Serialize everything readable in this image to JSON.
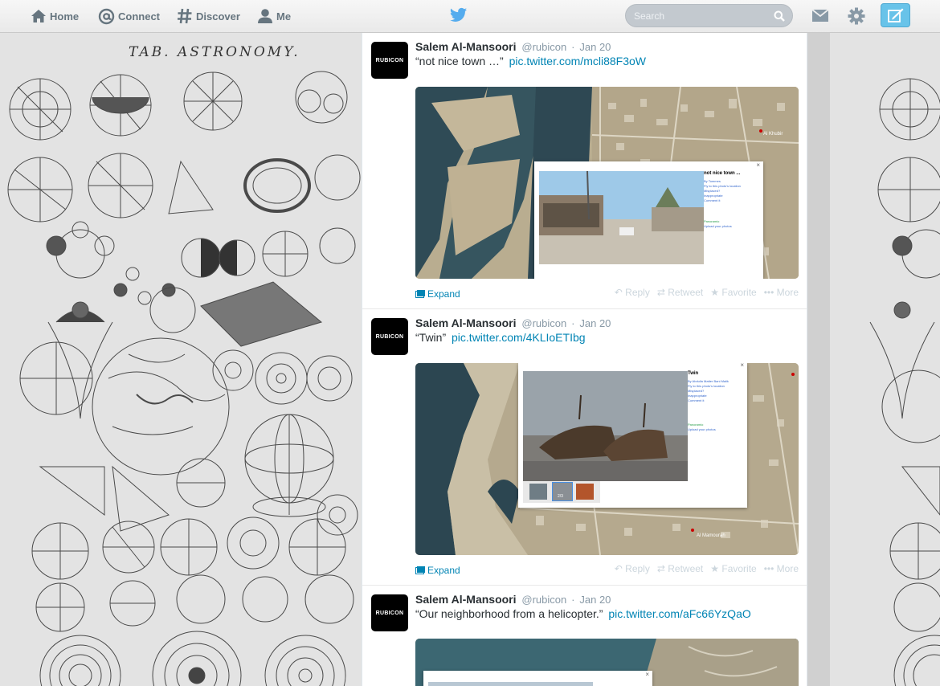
{
  "nav": {
    "home": "Home",
    "connect": "Connect",
    "discover": "Discover",
    "me": "Me"
  },
  "search": {
    "placeholder": "Search"
  },
  "background": {
    "plate_title": "TAB. ASTRONOMY."
  },
  "tweets": [
    {
      "avatar_text": "RUBICON",
      "fullname": "Salem Al-Mansoori",
      "screenname": "@rubicon",
      "time": "Jan 20",
      "text": "“not nice town …”",
      "link": "pic.twitter.com/mcli88F3oW",
      "popup_title": "not nice town ...",
      "popup_links": [
        "By Tommes",
        "Fly to this photo's location",
        "Misplaced?",
        "Inappropriate",
        "Comment it",
        "Panoramio",
        "Upload your photos"
      ],
      "map_label": "Al Khubir",
      "expand": "Expand",
      "actions": {
        "reply": "Reply",
        "retweet": "Retweet",
        "favorite": "Favorite",
        "more": "More"
      }
    },
    {
      "avatar_text": "RUBICON",
      "fullname": "Salem Al-Mansoori",
      "screenname": "@rubicon",
      "time": "Jan 20",
      "text": "“Twin”",
      "link": "pic.twitter.com/4KLIoETIbg",
      "popup_title": "Twin",
      "popup_links": [
        "By Abdulla Matter Bani Malik",
        "Fly to this photo's location",
        "Misplaced?",
        "Inappropriate",
        "Comment it",
        "Panoramio",
        "Upload your photos"
      ],
      "popup_counter": "2/3",
      "map_label": "Al Mamourah",
      "expand": "Expand",
      "actions": {
        "reply": "Reply",
        "retweet": "Retweet",
        "favorite": "Favorite",
        "more": "More"
      }
    },
    {
      "avatar_text": "RUBICON",
      "fullname": "Salem Al-Mansoori",
      "screenname": "@rubicon",
      "time": "Jan 20",
      "text": "“Our neighborhood from a helicopter.”",
      "link": "pic.twitter.com/aFc66YzQaO"
    }
  ],
  "colors": {
    "link": "#0084b4",
    "compose": "#68c3e9",
    "topbar_text": "#66757f",
    "muted": "#8899a6"
  }
}
